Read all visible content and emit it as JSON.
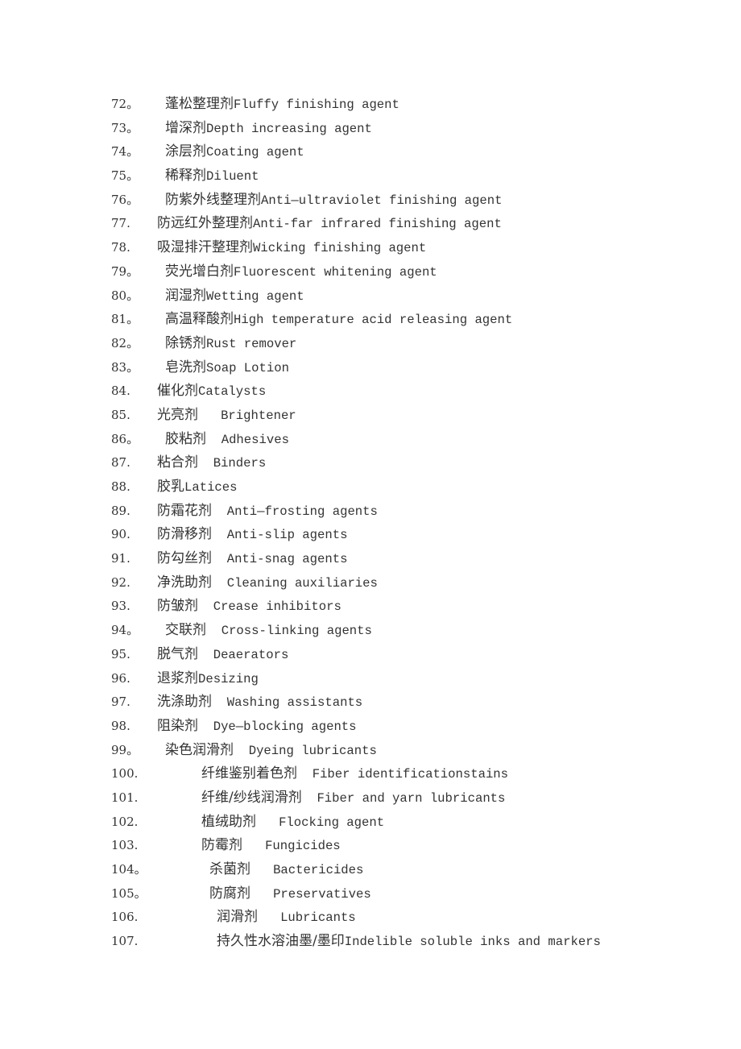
{
  "document": {
    "items": [
      {
        "num": "72。",
        "zh": "蓬松整理剂",
        "en": "Fluffy finishing agent",
        "sep": ""
      },
      {
        "num": "73。",
        "zh": "增深剂",
        "en": "Depth increasing agent",
        "sep": ""
      },
      {
        "num": "74。",
        "zh": "涂层剂",
        "en": "Coating agent",
        "sep": ""
      },
      {
        "num": "75。",
        "zh": "稀释剂",
        "en": "Diluent",
        "sep": ""
      },
      {
        "num": "76。",
        "zh": "防紫外线整理剂",
        "en": "Anti—ultraviolet finishing agent",
        "sep": ""
      },
      {
        "num": "77.",
        "zh": "防远红外整理剂",
        "en": "Anti-far infrared finishing agent",
        "sep": ""
      },
      {
        "num": "78.",
        "zh": "吸湿排汗整理剂",
        "en": "Wicking finishing agent",
        "sep": ""
      },
      {
        "num": "79。",
        "zh": "荧光增白剂",
        "en": "Fluorescent whitening agent",
        "sep": ""
      },
      {
        "num": "80。",
        "zh": "润湿剂",
        "en": "Wetting agent",
        "sep": ""
      },
      {
        "num": "81。",
        "zh": "高温释酸剂",
        "en": "High temperature acid releasing agent",
        "sep": ""
      },
      {
        "num": "82。",
        "zh": "除锈剂",
        "en": "Rust remover",
        "sep": ""
      },
      {
        "num": "83。",
        "zh": "皂洗剂",
        "en": "Soap Lotion",
        "sep": ""
      },
      {
        "num": "84.",
        "zh": "催化剂",
        "en": "Catalysts",
        "sep": ""
      },
      {
        "num": "85.",
        "zh": "光亮剂",
        "en": "Brightener",
        "sep": "   "
      },
      {
        "num": "86。",
        "zh": "胶粘剂",
        "en": "Adhesives",
        "sep": "  "
      },
      {
        "num": "87.",
        "zh": "粘合剂",
        "en": "Binders",
        "sep": "  "
      },
      {
        "num": "88.",
        "zh": "胶乳",
        "en": "Latices",
        "sep": ""
      },
      {
        "num": "89.",
        "zh": "防霜花剂",
        "en": "Anti—frosting agents",
        "sep": "  "
      },
      {
        "num": "90.",
        "zh": "防滑移剂",
        "en": "Anti-slip agents",
        "sep": "  "
      },
      {
        "num": "91.",
        "zh": "防勾丝剂",
        "en": "Anti-snag agents",
        "sep": "  "
      },
      {
        "num": "92.",
        "zh": "净洗助剂",
        "en": "Cleaning auxiliaries",
        "sep": "  "
      },
      {
        "num": "93.",
        "zh": "防皱剂",
        "en": "Crease inhibitors",
        "sep": "  "
      },
      {
        "num": "94。",
        "zh": "交联剂",
        "en": "Cross-linking agents",
        "sep": "  "
      },
      {
        "num": "95.",
        "zh": "脱气剂",
        "en": "Deaerators",
        "sep": "  "
      },
      {
        "num": "96.",
        "zh": "退浆剂",
        "en": "Desizing",
        "sep": ""
      },
      {
        "num": "97.",
        "zh": "洗涤助剂",
        "en": "Washing assistants",
        "sep": "  "
      },
      {
        "num": "98.",
        "zh": "阻染剂",
        "en": "Dye—blocking agents",
        "sep": "  "
      },
      {
        "num": "99。",
        "zh": "染色润滑剂",
        "en": "Dyeing lubricants",
        "sep": "  "
      },
      {
        "num": "100.",
        "zh": "纤维鉴别着色剂",
        "en": "Fiber identificationstains",
        "sep": "  "
      },
      {
        "num": "101.",
        "zh": "纤维/纱线润滑剂",
        "en": "Fiber and yarn lubricants",
        "sep": "  "
      },
      {
        "num": "102.",
        "zh": "植绒助剂",
        "en": "Flocking agent",
        "sep": "   "
      },
      {
        "num": "103.",
        "zh": "防霉剂",
        "en": "Fungicides",
        "sep": "   "
      },
      {
        "num": "104。",
        "zh": "杀菌剂",
        "en": "Bactericides",
        "sep": "   "
      },
      {
        "num": "105。",
        "zh": "防腐剂",
        "en": "Preservatives",
        "sep": "   "
      },
      {
        "num": "106.",
        "zh": "润滑剂",
        "en": "Lubricants",
        "sep": "   "
      },
      {
        "num": "107.",
        "zh": "持久性水溶油墨/墨印",
        "en": "Indelible soluble inks and markers",
        "sep": ""
      }
    ]
  }
}
